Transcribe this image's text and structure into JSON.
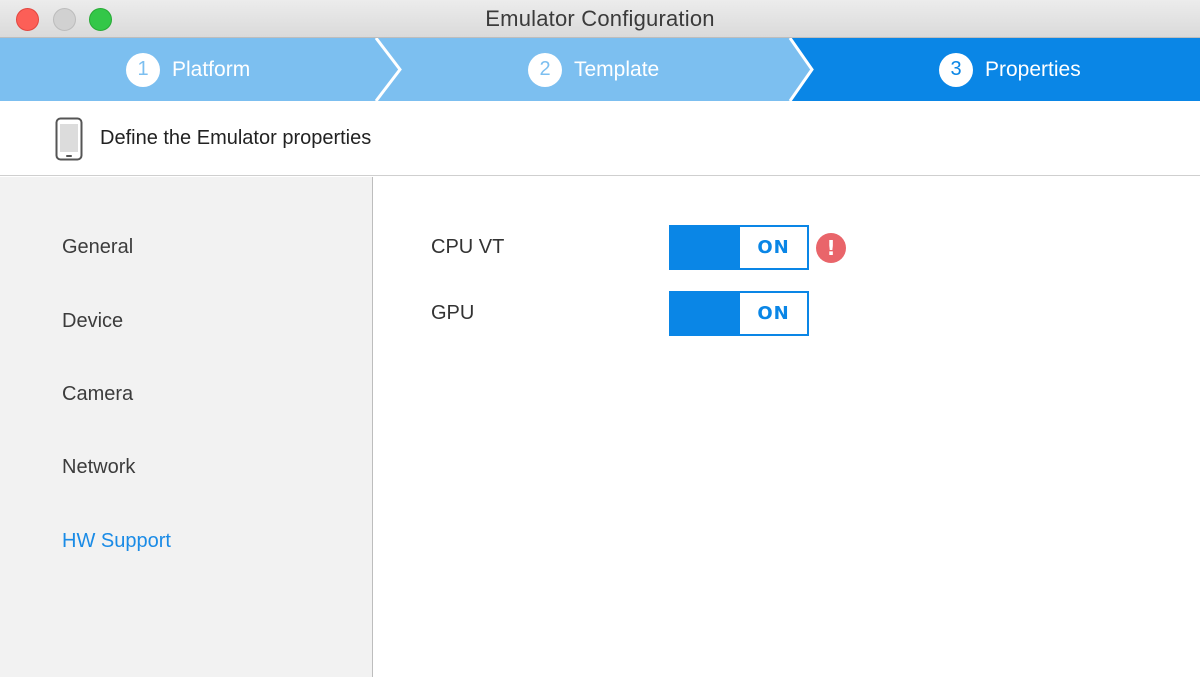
{
  "window": {
    "title": "Emulator Configuration"
  },
  "steps": [
    {
      "number": "1",
      "label": "Platform",
      "state": "done"
    },
    {
      "number": "2",
      "label": "Template",
      "state": "done"
    },
    {
      "number": "3",
      "label": "Properties",
      "state": "active"
    }
  ],
  "header": {
    "text": "Define the Emulator properties",
    "icon": "phone-icon"
  },
  "sidebar": {
    "items": [
      {
        "label": "General"
      },
      {
        "label": "Device"
      },
      {
        "label": "Camera"
      },
      {
        "label": "Network"
      },
      {
        "label": "HW Support",
        "selected": true
      }
    ]
  },
  "properties": [
    {
      "label": "CPU VT",
      "toggle": "ON",
      "warning": "!"
    },
    {
      "label": "GPU",
      "toggle": "ON"
    }
  ],
  "colors": {
    "accent": "#0a86e6",
    "step_inactive": "#7cbff0",
    "warning": "#e9656a"
  }
}
